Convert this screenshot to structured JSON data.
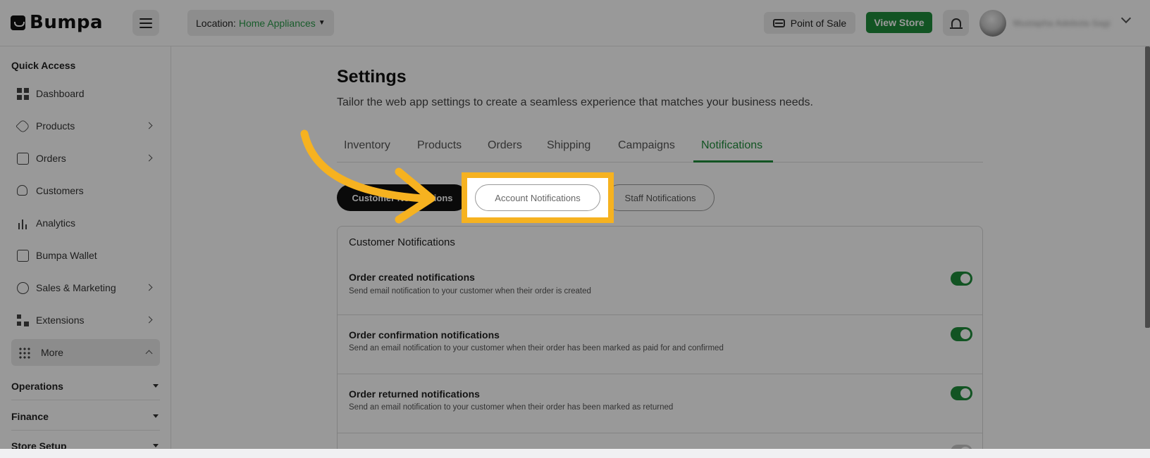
{
  "brand": {
    "name": "Bumpa"
  },
  "topbar": {
    "location_label": "Location:",
    "location_value": "Home Appliances",
    "pos_label": "Point of Sale",
    "view_store_label": "View Store",
    "username": "Mustapha Adebola-Sagi"
  },
  "sidebar": {
    "quick_access_label": "Quick Access",
    "items": [
      {
        "label": "Dashboard",
        "icon": "dashboard-icon"
      },
      {
        "label": "Products",
        "icon": "tag-icon"
      },
      {
        "label": "Orders",
        "icon": "bag-icon"
      },
      {
        "label": "Customers",
        "icon": "users-icon"
      },
      {
        "label": "Analytics",
        "icon": "bar-chart-icon"
      },
      {
        "label": "Bumpa Wallet",
        "icon": "wallet-icon"
      },
      {
        "label": "Sales & Marketing",
        "icon": "percent-icon"
      },
      {
        "label": "Extensions",
        "icon": "extensions-icon"
      },
      {
        "label": "More",
        "icon": "dots-grid-icon"
      }
    ],
    "sections": [
      "Operations",
      "Finance",
      "Store Setup"
    ]
  },
  "settings": {
    "title": "Settings",
    "subtitle": "Tailor the web app settings to create a seamless experience that matches your business needs.",
    "tabs": [
      "Inventory",
      "Products",
      "Orders",
      "Shipping",
      "Campaigns",
      "Notifications"
    ],
    "active_tab": "Notifications",
    "sub_tabs": [
      "Customer Notifications",
      "Account Notifications",
      "Staff Notifications"
    ],
    "active_sub_tab": "Customer Notifications",
    "highlighted_sub_tab": "Account Notifications"
  },
  "card": {
    "title": "Customer Notifications",
    "rows": [
      {
        "title": "Order created notifications",
        "desc": "Send email notification to your customer when their order is created",
        "enabled": true
      },
      {
        "title": "Order confirmation notifications",
        "desc": "Send an email notification to your customer when their order has been marked as paid for and confirmed",
        "enabled": true
      },
      {
        "title": "Order returned notifications",
        "desc": "Send an email notification to your customer when their order has been marked as returned",
        "enabled": true
      },
      {
        "title": "",
        "desc": "",
        "enabled": false
      }
    ]
  },
  "colors": {
    "accent_green": "#1f8c3b",
    "highlight_yellow": "#f6b220",
    "overlay": "rgba(0,0,0,0.40)"
  }
}
